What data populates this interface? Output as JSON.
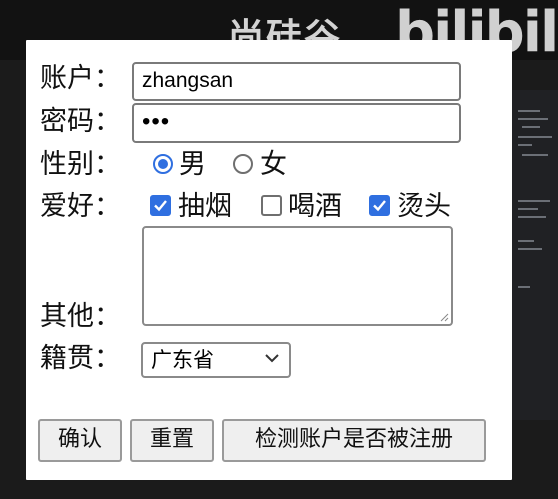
{
  "background": {
    "watermark_text": "尚硅谷",
    "brand_text": "bilibili"
  },
  "form": {
    "account": {
      "label": "账户：",
      "value": "zhangsan"
    },
    "password": {
      "label": "密码：",
      "value": "•••"
    },
    "gender": {
      "label": "性别：",
      "options": [
        {
          "label": "男",
          "selected": true
        },
        {
          "label": "女",
          "selected": false
        }
      ]
    },
    "hobbies": {
      "label": "爱好：",
      "options": [
        {
          "label": "抽烟",
          "checked": true
        },
        {
          "label": "喝酒",
          "checked": false
        },
        {
          "label": "烫头",
          "checked": true
        }
      ]
    },
    "other": {
      "label": "其他：",
      "value": ""
    },
    "hometown": {
      "label": "籍贯：",
      "selected": "广东省"
    },
    "buttons": {
      "confirm": "确认",
      "reset": "重置",
      "check_account": "检测账户是否被注册"
    }
  },
  "colors": {
    "accent": "#2f6fe0",
    "panel_bg": "#ffffff",
    "page_bg": "#1b1b1b"
  }
}
